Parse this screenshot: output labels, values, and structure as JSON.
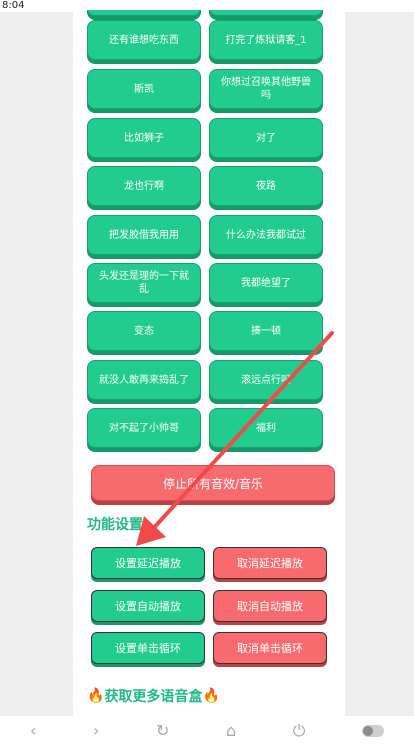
{
  "status": {
    "time": "8:04"
  },
  "sound_buttons": [
    {
      "label": "还有谁想吃东西"
    },
    {
      "label": "打完了炼狱请客_1"
    },
    {
      "label": "斯凯"
    },
    {
      "label": "你想过召唤其他野兽吗"
    },
    {
      "label": "比如狮子"
    },
    {
      "label": "对了"
    },
    {
      "label": "龙也行啊"
    },
    {
      "label": "夜路"
    },
    {
      "label": "把发胶借我用用"
    },
    {
      "label": "什么办法我都试过"
    },
    {
      "label": "头发还是理的一下就乱"
    },
    {
      "label": "我都绝望了"
    },
    {
      "label": "变态"
    },
    {
      "label": "揍一顿"
    },
    {
      "label": "就没人敢再来捣乱了"
    },
    {
      "label": "滚远点行吗"
    },
    {
      "label": "对不起了小帅哥"
    },
    {
      "label": "福利"
    }
  ],
  "stop_all_label": "停止所有音效/音乐",
  "settings": {
    "title": "功能设置",
    "set_delay": "设置延迟播放",
    "cancel_delay": "取消延迟播放",
    "set_auto": "设置自动播放",
    "cancel_auto": "取消自动播放",
    "set_loop": "设置单击循环",
    "cancel_loop": "取消单击循环"
  },
  "more_voice_label": "获取更多语音盒",
  "colors": {
    "green": "#22cc8f",
    "red": "#f76a6e",
    "accent_text": "#22b985",
    "arrow": "#ef4b4b"
  },
  "nav_icons": [
    "back-icon",
    "forward-icon",
    "refresh-icon",
    "home-icon",
    "power-icon",
    "toggle-icon"
  ]
}
